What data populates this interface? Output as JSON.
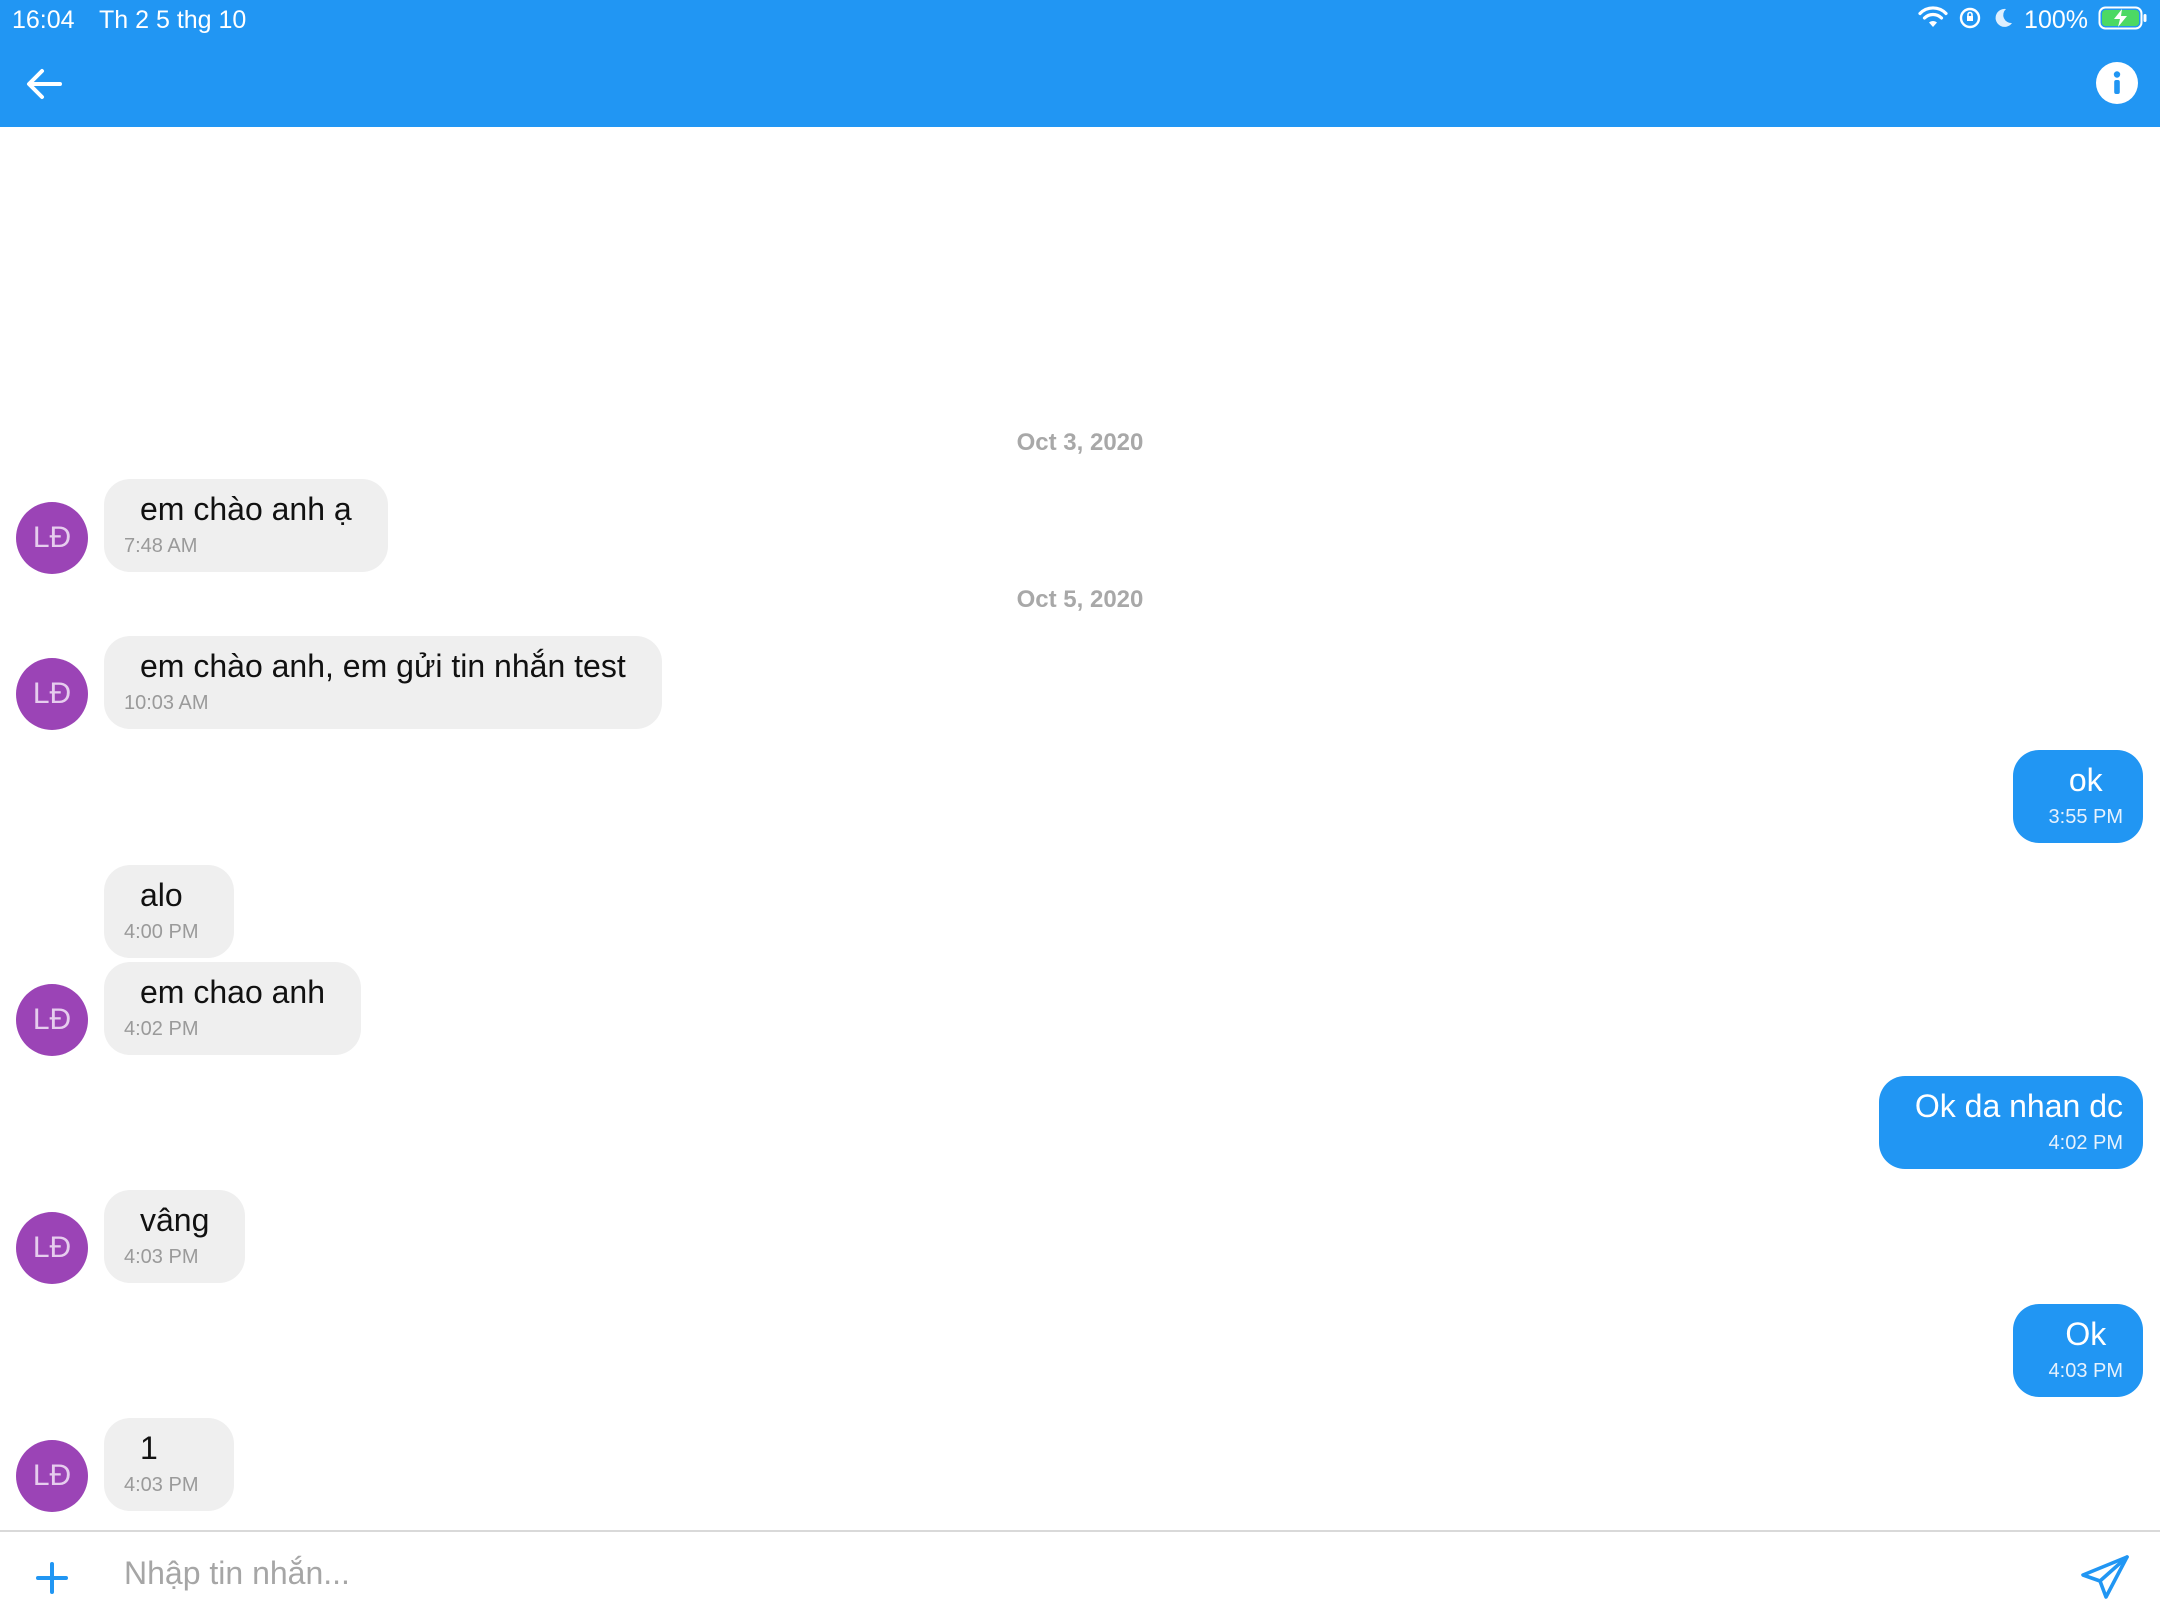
{
  "status_bar": {
    "time": "16:04",
    "date": "Th 2 5 thg 10",
    "battery": "100%"
  },
  "header": {
    "back_icon": "arrow-left-icon",
    "info_icon": "info-icon",
    "color": "#2196f3"
  },
  "contact": {
    "initials": "LĐ",
    "avatar_color": "#9b44b6"
  },
  "date_separators": [
    "Oct 3, 2020",
    "Oct 5, 2020"
  ],
  "messages": [
    {
      "direction": "in",
      "text": "em chào anh ạ",
      "time": "7:48 AM",
      "avatar": true
    },
    {
      "direction": "in",
      "text": "em chào anh, em gửi tin nhắn test",
      "time": "10:03 AM",
      "avatar": true
    },
    {
      "direction": "out",
      "text": "ok",
      "time": "3:55 PM"
    },
    {
      "direction": "in",
      "text": "alo",
      "time": "4:00 PM",
      "avatar": false
    },
    {
      "direction": "in",
      "text": "em chao anh",
      "time": "4:02 PM",
      "avatar": true
    },
    {
      "direction": "out",
      "text": "Ok da nhan dc",
      "time": "4:02 PM"
    },
    {
      "direction": "in",
      "text": "vâng",
      "time": "4:03 PM",
      "avatar": true
    },
    {
      "direction": "out",
      "text": "Ok",
      "time": "4:03 PM"
    },
    {
      "direction": "in",
      "text": "1",
      "time": "4:03 PM",
      "avatar": true
    }
  ],
  "composer": {
    "placeholder": "Nhập tin nhắn...",
    "add_icon": "plus-icon",
    "send_icon": "send-icon"
  }
}
